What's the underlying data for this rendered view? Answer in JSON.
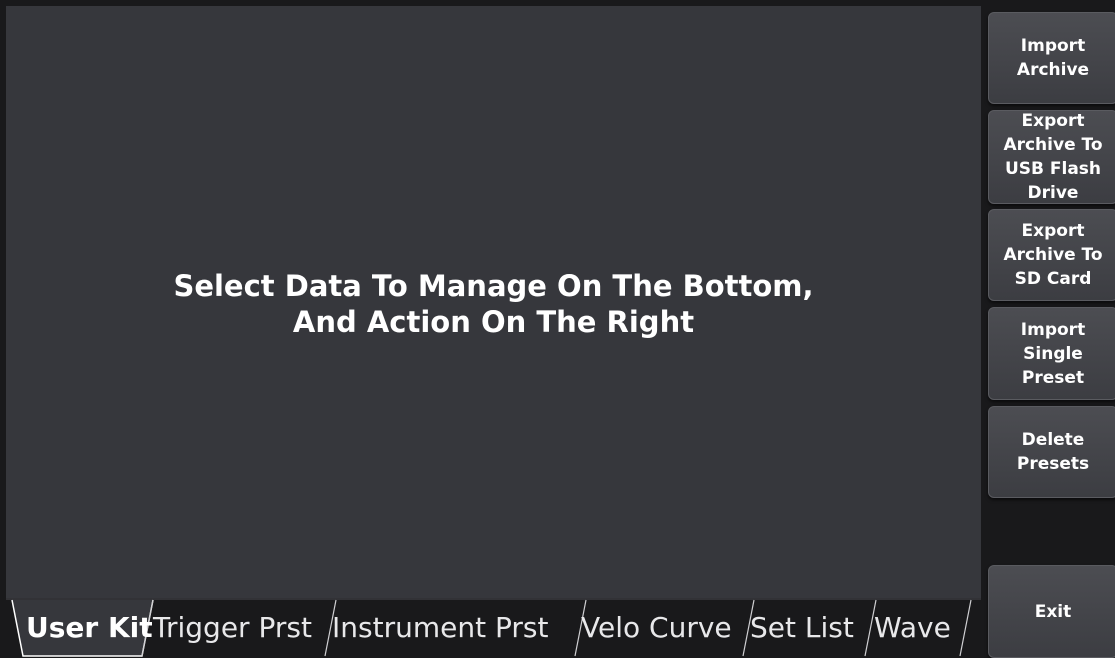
{
  "message": {
    "line1": "Select Data To Manage On The Bottom,",
    "line2": "And Action On The Right"
  },
  "sidebar": {
    "buttons": [
      {
        "name": "import-archive-button",
        "lines": [
          "Import",
          "Archive"
        ]
      },
      {
        "name": "export-archive-usb-button",
        "lines": [
          "Export",
          "Archive To",
          "USB Flash",
          "Drive"
        ]
      },
      {
        "name": "export-archive-sd-button",
        "lines": [
          "Export",
          "Archive To",
          "SD Card"
        ]
      },
      {
        "name": "import-single-preset-button",
        "lines": [
          "Import",
          "Single",
          "Preset"
        ]
      },
      {
        "name": "delete-presets-button",
        "lines": [
          "Delete",
          "Presets"
        ]
      }
    ],
    "exit_label": "Exit"
  },
  "tabs": [
    {
      "label": "User Kit",
      "active": true
    },
    {
      "label": "Trigger Prst",
      "active": false
    },
    {
      "label": "Instrument Prst",
      "active": false
    },
    {
      "label": "Velo Curve",
      "active": false
    },
    {
      "label": "Set List",
      "active": false
    },
    {
      "label": "Wave",
      "active": false
    }
  ],
  "colors": {
    "panel": "#36373c",
    "background": "#19191b",
    "button": "#45464b",
    "text": "#ffffff"
  }
}
